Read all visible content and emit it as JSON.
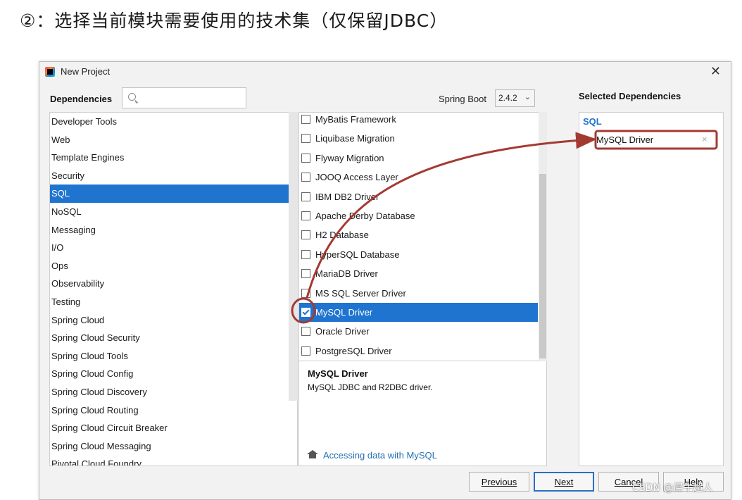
{
  "heading": "②：选择当前模块需要使用的技术集（仅保留JDBC）",
  "window": {
    "title": "New Project"
  },
  "dependencies": {
    "label": "Dependencies",
    "search_value": ""
  },
  "spring_boot": {
    "label": "Spring Boot",
    "version": "2.4.2"
  },
  "categories": [
    "Developer Tools",
    "Web",
    "Template Engines",
    "Security",
    "SQL",
    "NoSQL",
    "Messaging",
    "I/O",
    "Ops",
    "Observability",
    "Testing",
    "Spring Cloud",
    "Spring Cloud Security",
    "Spring Cloud Tools",
    "Spring Cloud Config",
    "Spring Cloud Discovery",
    "Spring Cloud Routing",
    "Spring Cloud Circuit Breaker",
    "Spring Cloud Messaging",
    "Pivotal Cloud Foundry"
  ],
  "active_category": "SQL",
  "dependency_items": [
    {
      "label": "MyBatis Framework",
      "checked": false
    },
    {
      "label": "Liquibase Migration",
      "checked": false
    },
    {
      "label": "Flyway Migration",
      "checked": false
    },
    {
      "label": "JOOQ Access Layer",
      "checked": false
    },
    {
      "label": "IBM DB2 Driver",
      "checked": false
    },
    {
      "label": "Apache Derby Database",
      "checked": false
    },
    {
      "label": "H2 Database",
      "checked": false
    },
    {
      "label": "HyperSQL Database",
      "checked": false
    },
    {
      "label": "MariaDB Driver",
      "checked": false
    },
    {
      "label": "MS SQL Server Driver",
      "checked": false
    },
    {
      "label": "MySQL Driver",
      "checked": true
    },
    {
      "label": "Oracle Driver",
      "checked": false
    },
    {
      "label": "PostgreSQL Driver",
      "checked": false
    }
  ],
  "detail": {
    "title": "MySQL Driver",
    "description": "MySQL JDBC and R2DBC driver.",
    "link": "Accessing data with MySQL"
  },
  "selected": {
    "title": "Selected Dependencies",
    "group": "SQL",
    "items": [
      "MySQL Driver"
    ],
    "remove_glyph": "×"
  },
  "buttons": {
    "previous": "Previous",
    "next": "Next",
    "cancel": "Cancel",
    "help": "Help"
  },
  "watermark": "CSDN @犀牛超人",
  "colors": {
    "selection": "#1f74cf",
    "annotation": "#a33a32",
    "link": "#2470b3"
  }
}
